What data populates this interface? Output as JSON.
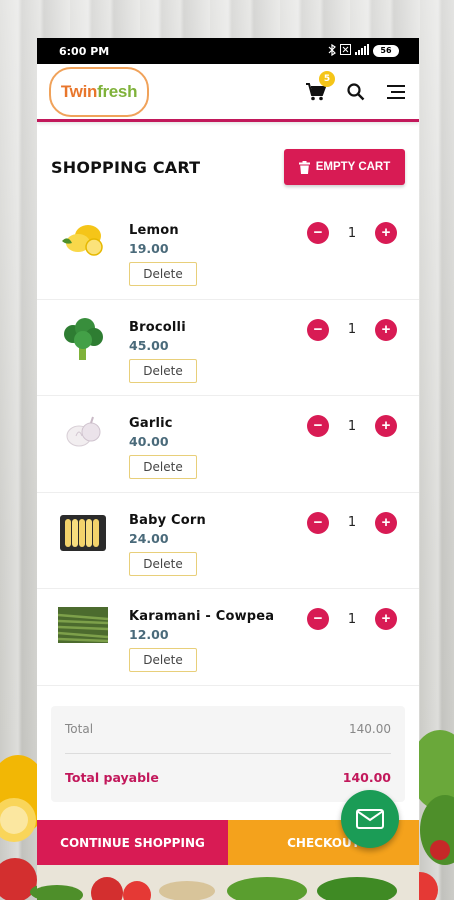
{
  "status_bar": {
    "time": "6:00 PM",
    "battery": "56"
  },
  "header": {
    "logo_part1": "Twin ",
    "logo_part2": "fresh",
    "cart_count": "5"
  },
  "page": {
    "title": "SHOPPING CART",
    "empty_cart_label": "EMPTY CART"
  },
  "cart_items": [
    {
      "name": "Lemon",
      "price": "19.00",
      "qty": "1",
      "delete_label": "Delete",
      "icon": "lemon-icon"
    },
    {
      "name": "Brocolli",
      "price": "45.00",
      "qty": "1",
      "delete_label": "Delete",
      "icon": "broccoli-icon"
    },
    {
      "name": "Garlic",
      "price": "40.00",
      "qty": "1",
      "delete_label": "Delete",
      "icon": "garlic-icon"
    },
    {
      "name": "Baby Corn",
      "price": "24.00",
      "qty": "1",
      "delete_label": "Delete",
      "icon": "baby-corn-icon"
    },
    {
      "name": "Karamani - Cowpea",
      "price": "12.00",
      "qty": "1",
      "delete_label": "Delete",
      "icon": "cowpea-icon"
    }
  ],
  "summary": {
    "total_label": "Total",
    "total_value": "140.00",
    "payable_label": "Total payable",
    "payable_value": "140.00"
  },
  "footer": {
    "continue_label": "CONTINUE SHOPPING",
    "checkout_label": "CHECKOUT"
  },
  "colors": {
    "primary": "#d81b54",
    "checkout": "#f4a21c",
    "fab": "#1b9c56",
    "price": "#4a6a7a"
  }
}
